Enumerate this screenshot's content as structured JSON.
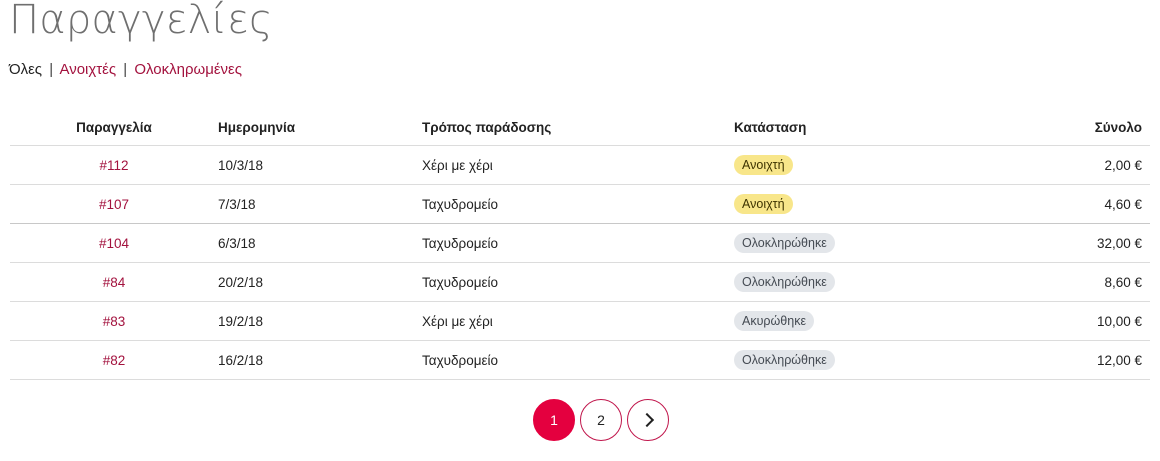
{
  "page": {
    "title": "Παραγγελίες"
  },
  "filters": {
    "all": "Όλες",
    "open": "Ανοιχτές",
    "completed": "Ολοκληρωμένες",
    "separator": "|"
  },
  "table": {
    "headers": {
      "order": "Παραγγελία",
      "date": "Ημερομηνία",
      "shipping": "Τρόπος παράδοσης",
      "status": "Κατάσταση",
      "total": "Σύνολο"
    },
    "rows": [
      {
        "order": "#112",
        "date": "10/3/18",
        "shipping": "Χέρι με χέρι",
        "status": "Ανοιχτή",
        "total": "2,00 €"
      },
      {
        "order": "#107",
        "date": "7/3/18",
        "shipping": "Ταχυδρομείο",
        "status": "Ανοιχτή",
        "total": "4,60 €"
      },
      {
        "order": "#104",
        "date": "6/3/18",
        "shipping": "Ταχυδρομείο",
        "status": "Ολοκληρώθηκε",
        "total": "32,00 €"
      },
      {
        "order": "#84",
        "date": "20/2/18",
        "shipping": "Ταχυδρομείο",
        "status": "Ολοκληρώθηκε",
        "total": "8,60 €"
      },
      {
        "order": "#83",
        "date": "19/2/18",
        "shipping": "Χέρι με χέρι",
        "status": "Ακυρώθηκε",
        "total": "10,00 €"
      },
      {
        "order": "#82",
        "date": "16/2/18",
        "shipping": "Ταχυδρομείο",
        "status": "Ολοκληρώθηκε",
        "total": "12,00 €"
      }
    ]
  },
  "pagination": {
    "pages": [
      "1",
      "2"
    ],
    "current": "1",
    "next_icon": "chevron-right-icon"
  },
  "colors": {
    "accent": "#a3123e",
    "active_page": "#e4003f",
    "badge_open": "#f8e68a",
    "badge_neutral": "#e3e6ea"
  }
}
